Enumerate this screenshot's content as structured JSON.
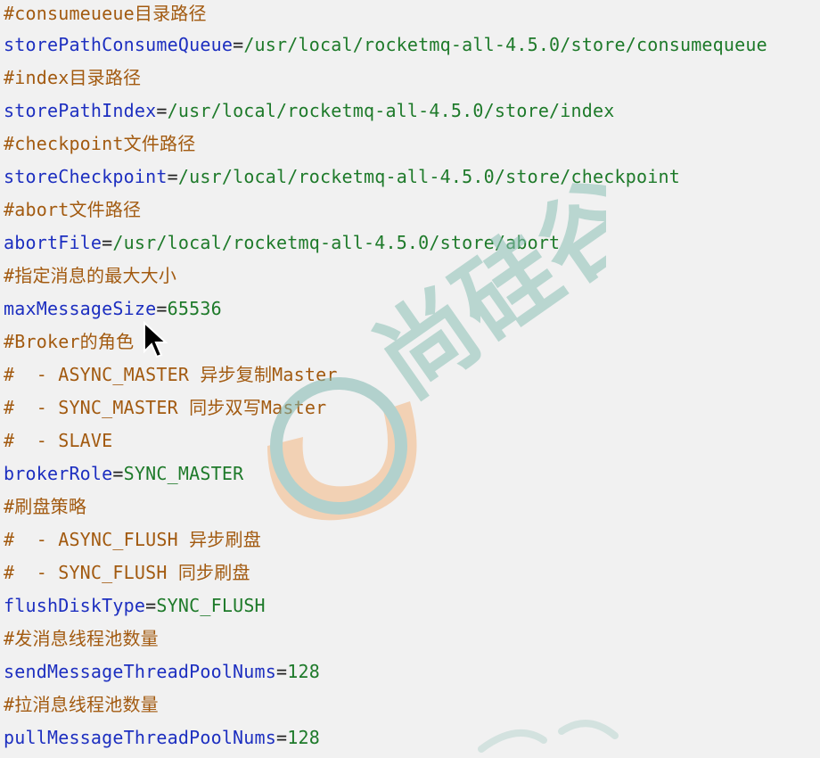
{
  "lines": [
    {
      "type": "comment",
      "text": "#consumeueue目录路径"
    },
    {
      "type": "kv",
      "key": "storePathConsumeQueue",
      "value": "/usr/local/rocketmq-all-4.5.0/store/consumequeue"
    },
    {
      "type": "comment",
      "text": "#index目录路径"
    },
    {
      "type": "kv",
      "key": "storePathIndex",
      "value": "/usr/local/rocketmq-all-4.5.0/store/index"
    },
    {
      "type": "comment",
      "text": "#checkpoint文件路径"
    },
    {
      "type": "kv",
      "key": "storeCheckpoint",
      "value": "/usr/local/rocketmq-all-4.5.0/store/checkpoint"
    },
    {
      "type": "comment",
      "text": "#abort文件路径"
    },
    {
      "type": "kv",
      "key": "abortFile",
      "value": "/usr/local/rocketmq-all-4.5.0/store/abort"
    },
    {
      "type": "comment",
      "text": "#指定消息的最大大小"
    },
    {
      "type": "kv",
      "key": "maxMessageSize",
      "value": "65536"
    },
    {
      "type": "comment",
      "text": "#Broker的角色"
    },
    {
      "type": "comment",
      "text": "#  - ASYNC_MASTER 异步复制Master"
    },
    {
      "type": "comment",
      "text": "#  - SYNC_MASTER 同步双写Master"
    },
    {
      "type": "comment",
      "text": "#  - SLAVE"
    },
    {
      "type": "kv",
      "key": "brokerRole",
      "value": "SYNC_MASTER"
    },
    {
      "type": "comment",
      "text": "#刷盘策略"
    },
    {
      "type": "comment",
      "text": "#  - ASYNC_FLUSH 异步刷盘"
    },
    {
      "type": "comment",
      "text": "#  - SYNC_FLUSH 同步刷盘"
    },
    {
      "type": "kv",
      "key": "flushDiskType",
      "value": "SYNC_FLUSH"
    },
    {
      "type": "comment",
      "text": "#发消息线程池数量"
    },
    {
      "type": "kv",
      "key": "sendMessageThreadPoolNums",
      "value": "128"
    },
    {
      "type": "comment",
      "text": "#拉消息线程池数量"
    },
    {
      "type": "kv",
      "key": "pullMessageThreadPoolNums",
      "value": "128"
    }
  ],
  "separator": "=",
  "watermark": {
    "text": "尚硅谷"
  },
  "colors": {
    "comment": "#a25a10",
    "key": "#1d2fc0",
    "value": "#1e7a2a",
    "background": "#f1f1f1"
  }
}
